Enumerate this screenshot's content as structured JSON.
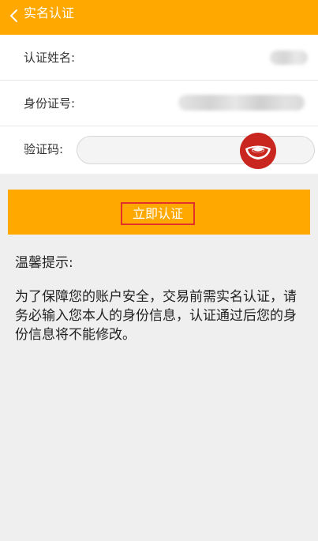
{
  "header": {
    "back_icon": "chevron-left-icon",
    "title": "实名认证"
  },
  "form": {
    "name_label": "认证姓名:",
    "id_label": "身份证号:",
    "captcha_label": "验证码:",
    "captcha_value": "",
    "captcha_image_icon": "gold-ingot-icon"
  },
  "submit": {
    "label": "立即认证"
  },
  "tips": {
    "title": "温馨提示:",
    "body": "为了保障您的账户安全，交易前需实名认证，请务必输入您本人的身份信息，认证通过后您的身份信息将不能修改。"
  },
  "colors": {
    "accent": "#ffa800",
    "background": "#efefef",
    "highlight_border": "#e2302a",
    "captcha_red": "#c8261e"
  }
}
